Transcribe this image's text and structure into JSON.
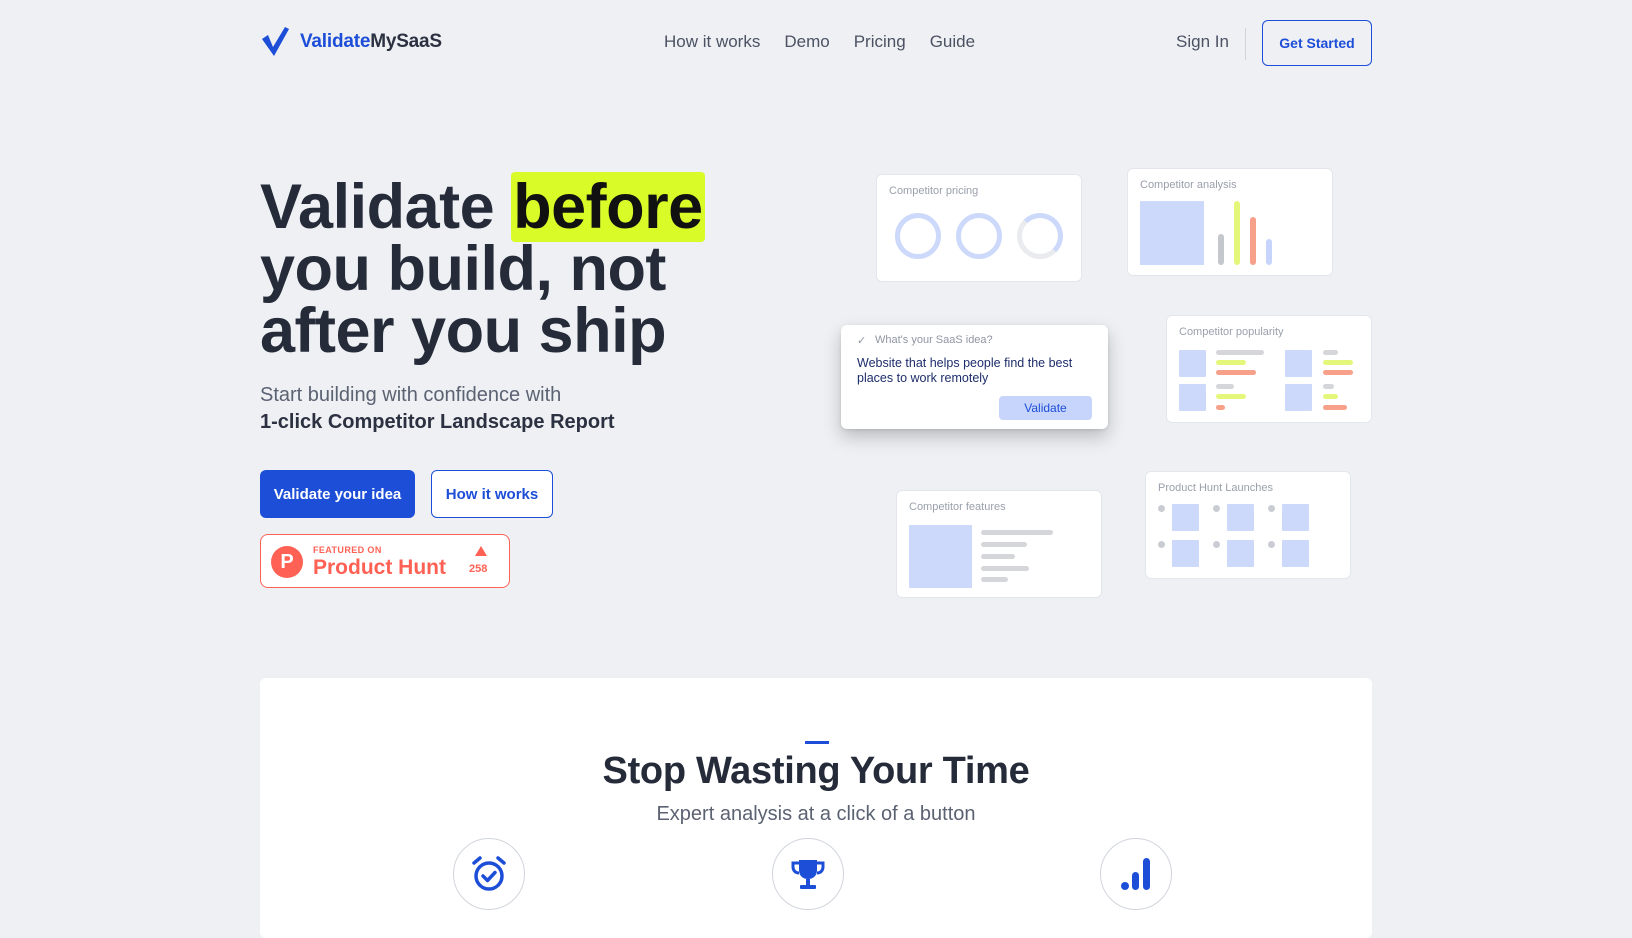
{
  "header": {
    "logo_part1": "Validate",
    "logo_part2": "MySaaS",
    "nav": [
      "How it works",
      "Demo",
      "Pricing",
      "Guide"
    ],
    "sign_in": "Sign In",
    "get_started": "Get Started"
  },
  "hero": {
    "title_word1": "Validate",
    "title_highlight": "before",
    "title_line2": "you build, not",
    "title_line3": "after you ship",
    "subtitle": "Start building with confidence with",
    "subtitle_bold": "1-click Competitor Landscape Report",
    "cta_primary": "Validate your idea",
    "cta_secondary": "How it works",
    "product_hunt": {
      "featured": "FEATURED ON",
      "name": "Product Hunt",
      "votes": "258"
    }
  },
  "illustration": {
    "pricing_title": "Competitor pricing",
    "analysis_title": "Competitor analysis",
    "popularity_title": "Competitor popularity",
    "features_title": "Competitor features",
    "launches_title": "Product Hunt Launches",
    "idea_question": "What's your SaaS idea?",
    "idea_text": "Website that helps people find the best places to work remotely",
    "idea_button": "Validate"
  },
  "section": {
    "title": "Stop Wasting Your Time",
    "subtitle": "Expert analysis at a click of a button",
    "icons": [
      "alarm-clock-icon",
      "trophy-icon",
      "bar-chart-icon"
    ]
  },
  "colors": {
    "brand": "#1d4ed8",
    "highlight": "#d9fb28",
    "product_hunt": "#ff6154",
    "background": "#eef0f4"
  }
}
